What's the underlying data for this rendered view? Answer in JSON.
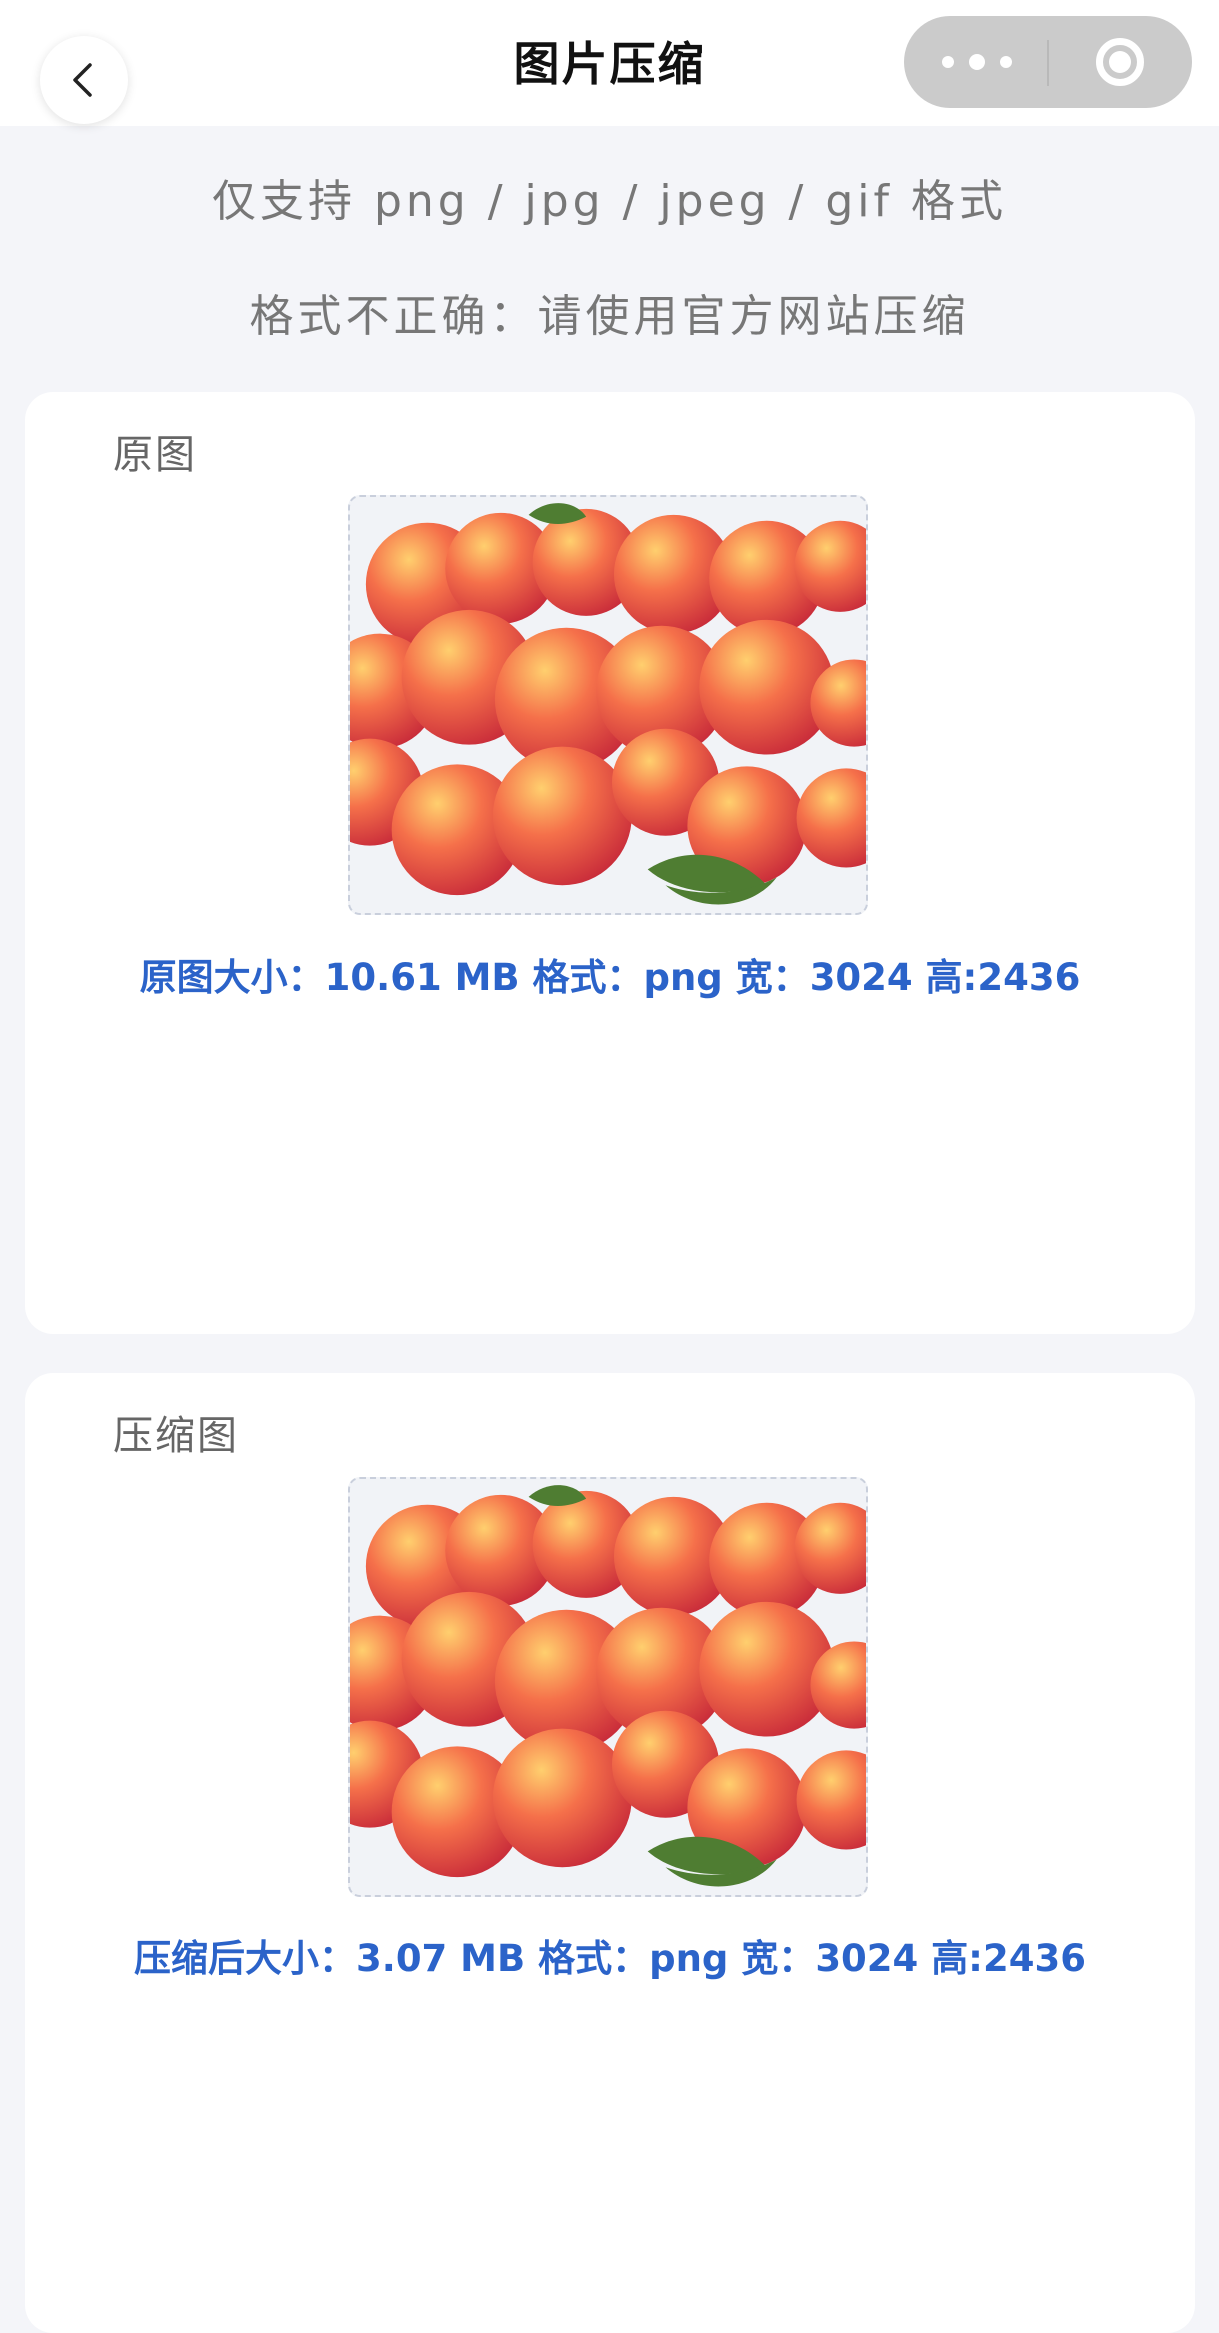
{
  "nav": {
    "title": "图片压缩"
  },
  "notices": {
    "formats": "仅支持 png / jpg / jpeg / gif 格式",
    "incorrect": "格式不正确：请使用官方网站压缩"
  },
  "original": {
    "label": "原图",
    "size_label": "原图大小：",
    "size": "10.61 MB",
    "format_label": "格式：",
    "format": "png",
    "width_label": "宽：",
    "width": "3024",
    "height_label": "高:",
    "height": "2436"
  },
  "compressed": {
    "label": "压缩图",
    "size_label": "压缩后大小：",
    "size": "3.07 MB",
    "format_label": "格式：",
    "format": "png",
    "width_label": "宽：",
    "width": "3024",
    "height_label": "高:",
    "height": "2436"
  },
  "colors": {
    "accent": "#2b63c9",
    "background": "#f4f5f9",
    "capsule": "#cbcbcb"
  },
  "icons": [
    "chevron-left-icon",
    "more-icon",
    "close-target-icon",
    "peaches-image"
  ]
}
